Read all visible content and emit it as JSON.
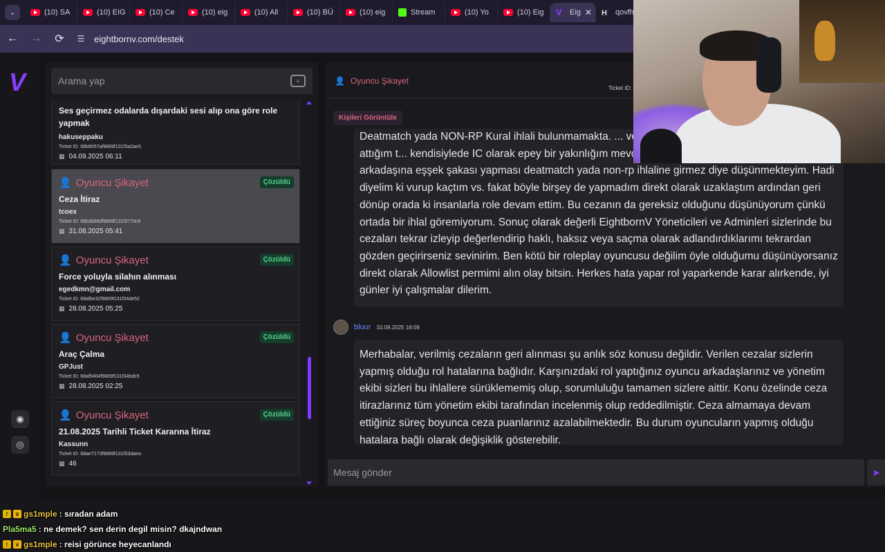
{
  "browser": {
    "tabs": [
      {
        "label": "(10) SA",
        "favicon": "youtube-icon"
      },
      {
        "label": "(10) EIG",
        "favicon": "youtube-icon"
      },
      {
        "label": "(10) Ce",
        "favicon": "youtube-icon"
      },
      {
        "label": "(10) eig",
        "favicon": "youtube-icon"
      },
      {
        "label": "(10) All",
        "favicon": "youtube-icon"
      },
      {
        "label": "(10) BÜ",
        "favicon": "youtube-icon"
      },
      {
        "label": "(10) eig",
        "favicon": "youtube-icon"
      },
      {
        "label": "Stream",
        "favicon": "kick-icon"
      },
      {
        "label": "(10) Yo",
        "favicon": "youtube-icon"
      },
      {
        "label": "(10) Eig",
        "favicon": "youtube-icon"
      },
      {
        "label": "Eig",
        "favicon": "eightborn-icon",
        "active": true
      },
      {
        "label": "qovfh",
        "favicon": "h-icon"
      }
    ],
    "url": "eightbornv.com/destek",
    "accent_color": "#3b3356"
  },
  "app": {
    "brand_color": "#8b3dff",
    "search_placeholder": "Arama yap",
    "tickets": [
      {
        "category": "",
        "title": "Ses geçirmez odalarda dışardaki sesi alıp ona göre role yapmak",
        "user": "hakuseppaku",
        "ticket_id": "Ticket ID: 68b9057af9869f131f3a2ae5",
        "date": "04.09.2025 06:11",
        "status": ""
      },
      {
        "category": "Oyuncu Şikayet",
        "title": "Ceza İtiraz",
        "user": "tcoex",
        "ticket_id": "Ticket ID: 68b3b66df9869f131f3770c6",
        "date": "31.08.2025 05:41",
        "status": "Çözüldü",
        "selected": true
      },
      {
        "category": "Oyuncu Şikayet",
        "title": "Force yoluyla silahın alınması",
        "user": "egedkmn@gmail.com",
        "ticket_id": "Ticket ID: 68afbe32f9869f131f34de52",
        "date": "28.08.2025 05:25",
        "status": "Çözüldü"
      },
      {
        "category": "Oyuncu Şikayet",
        "title": "Araç Çalma",
        "user": "GPJust",
        "ticket_id": "Ticket ID: 68af9404f9869f131f34bdc9",
        "date": "28.08.2025 02:25",
        "status": "Çözüldü"
      },
      {
        "category": "Oyuncu Şikayet",
        "title": "21.08.2025 Tarihli Ticket Kararına İtiraz",
        "user": "Kassunn",
        "ticket_id": "Ticket ID: 68ae7173f9869f131f33daea",
        "date": "46",
        "status": "Çözüldü"
      }
    ],
    "detail": {
      "category": "Oyuncu Şikayet",
      "ticket_label": "Ticket ID:",
      "people_button": "Kişileri Görüntüle",
      "messages": [
        {
          "text": "Deatmatch yada NON-RP Kural ihlali bulunmamakta. ... veya yaralayıp bayıltmadım o esnada tekme attığım t... kendisiylede IC olarak epey bir yakınlığım mevcut, haliyle Cemşit gibi bir karakterin arkadaşına eşşek şakası yapması deatmatch yada non-rp ihlaline girmez diye düşünmekteyim. Hadi diyelim ki vurup kaçtım vs. fakat böyle birşey de yapmadım direkt olarak uzaklaştım ardından geri dönüp orada ki insanlarla role devam ettim. Bu cezanın da gereksiz olduğunu düşünüyorum çünkü ortada bir ihlal göremiyorum. Sonuç olarak değerli EightbornV Yöneticileri ve Adminleri sizlerinde bu cezaları tekrar izleyip değerlendirip haklı, haksız veya saçma olarak adlandırdıklarımı tekrardan gözden geçirirseniz sevinirim. Ben kötü bir roleplay oyuncusu değilim öyle olduğumu düşünüyorsanız direkt olarak Allowlist permimi alın olay bitsin. Herkes hata yapar rol yaparkende karar alırkende, iyi günler iyi çalışmalar dilerim."
        },
        {
          "author": "bluur",
          "time": "10.09.2025 18:09",
          "text": "Merhabalar, verilmiş cezaların geri alınması şu anlık söz konusu değildir. Verilen cezalar sizlerin yapmış olduğu rol hatalarına bağlıdır. Karşınızdaki rol yaptığınız oyuncu arkadaşlarınız ve yönetim ekibi sizleri bu ihlallere sürüklememiş olup, sorumluluğu tamamen sizlere aittir. Konu özelinde ceza itirazlarınız tüm yönetim ekibi tarafından incelenmiş olup reddedilmiştir. Ceza almamaya devam ettiğiniz süreç boyunca ceza puanlarınız azalabilmektedir. Bu durum oyuncuların yapmış olduğu hatalara bağlı olarak değişiklik gösterebilir."
        }
      ],
      "composer_placeholder": "Mesaj gönder"
    }
  },
  "chat": [
    {
      "user": "gs1mple",
      "text": ": sıradan adam"
    },
    {
      "user": "Pla5ma5",
      "text": ": ne demek? sen derin degil misin? dkajndwan"
    },
    {
      "user": "gs1mple",
      "text": ": reisi görünce heyecanlandı"
    }
  ]
}
